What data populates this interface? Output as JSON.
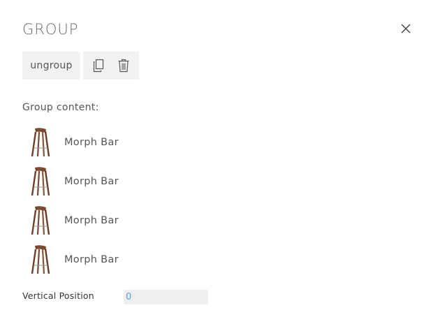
{
  "panel": {
    "title": "GROUP",
    "close_icon": "close-icon"
  },
  "toolbar": {
    "ungroup_label": "ungroup",
    "duplicate_icon": "duplicate-icon",
    "delete_icon": "trash-icon"
  },
  "group_content": {
    "label": "Group content:",
    "items": [
      {
        "label": "Morph Bar",
        "icon": "bar-stool-thumbnail"
      },
      {
        "label": "Morph Bar",
        "icon": "bar-stool-thumbnail"
      },
      {
        "label": "Morph Bar",
        "icon": "bar-stool-thumbnail"
      },
      {
        "label": "Morph Bar",
        "icon": "bar-stool-thumbnail"
      }
    ]
  },
  "vertical_position": {
    "label": "Vertical Position",
    "value": "0"
  },
  "colors": {
    "button_background": "#f2f2f2",
    "input_background": "#efefef",
    "input_text": "#4aa3d8",
    "stool_wood": "#7a4a30"
  }
}
